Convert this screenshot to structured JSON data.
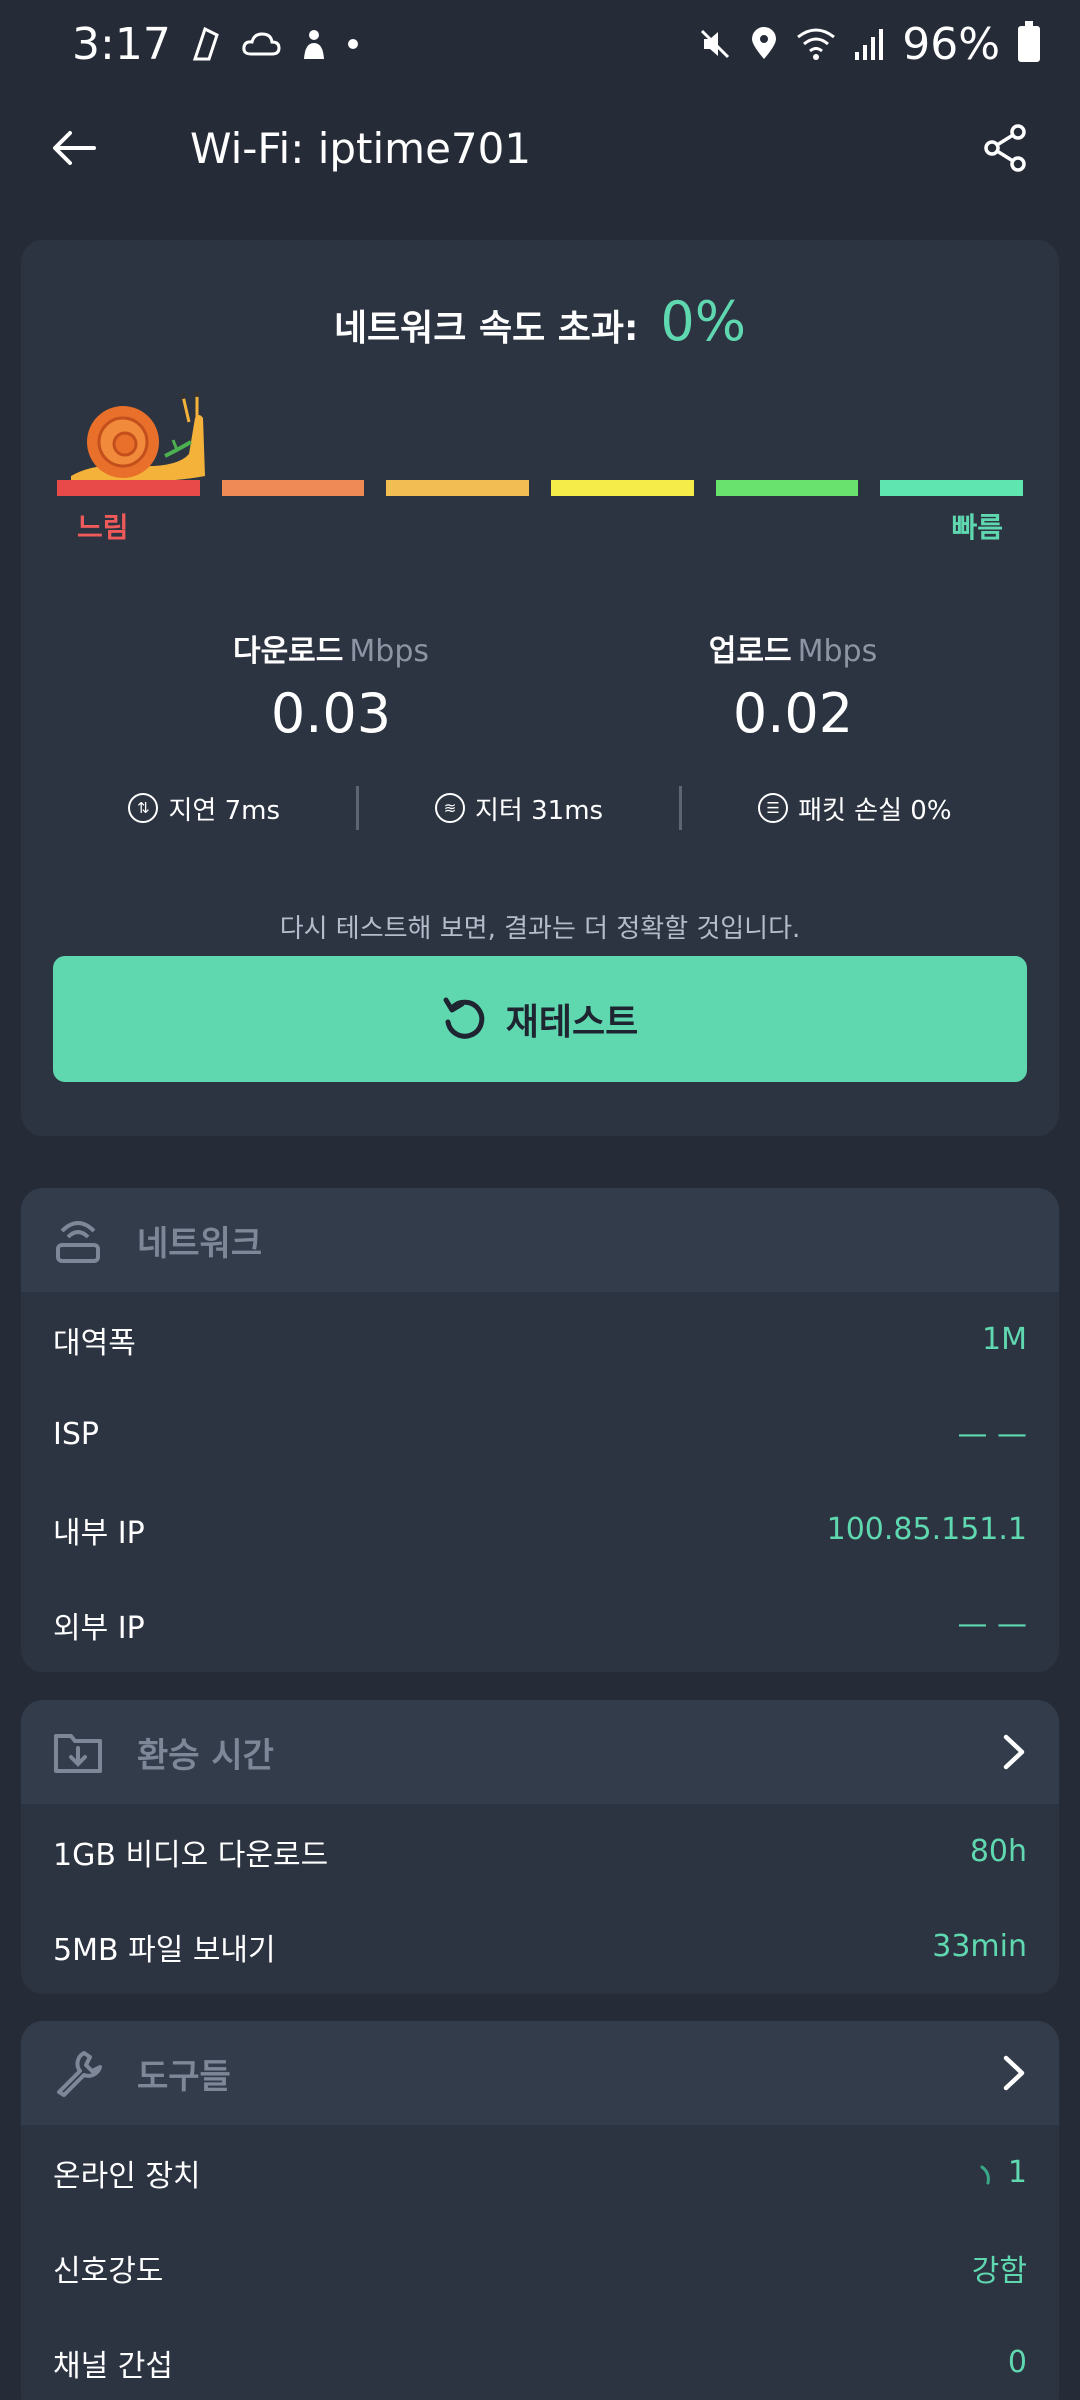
{
  "status_bar": {
    "time": "3:17",
    "battery": "96%"
  },
  "app_bar": {
    "title": "Wi-Fi: iptime701"
  },
  "result": {
    "headline_label": "네트워크 속도 초과:",
    "headline_value": "0%",
    "slow_label": "느림",
    "fast_label": "빠름",
    "speed_segments": [
      "#e84a4a",
      "#ef8a56",
      "#f2bd52",
      "#f5ec4a",
      "#6ae36e",
      "#5fe6b0"
    ],
    "download": {
      "label": "다운로드",
      "unit": "Mbps",
      "value": "0.03"
    },
    "upload": {
      "label": "업로드",
      "unit": "Mbps",
      "value": "0.02"
    },
    "stats": [
      {
        "icon": "latency-icon",
        "text": "지연 7ms"
      },
      {
        "icon": "jitter-icon",
        "text": "지터 31ms"
      },
      {
        "icon": "packet-loss-icon",
        "text": "패킷 손실 0%"
      }
    ],
    "hint": "다시 테스트해 보면, 결과는 더 정확할 것입니다.",
    "retest_label": "재테스트"
  },
  "network": {
    "title": "네트워크",
    "rows": [
      {
        "label": "대역폭",
        "value": "1M"
      },
      {
        "label": "ISP",
        "value": "— —"
      },
      {
        "label": "내부 IP",
        "value": "100.85.151.1"
      },
      {
        "label": "외부 IP",
        "value": "— —"
      }
    ]
  },
  "transfer": {
    "title": "환승 시간",
    "rows": [
      {
        "label": "1GB 비디오 다운로드",
        "value": "80h"
      },
      {
        "label": "5MB 파일 보내기",
        "value": "33min"
      }
    ]
  },
  "tools": {
    "title": "도구들",
    "rows": [
      {
        "label": "온라인 장치",
        "value": "1"
      },
      {
        "label": "신호강도",
        "value": "강함"
      },
      {
        "label": "채널 간섭",
        "value": "0"
      }
    ]
  },
  "colors": {
    "accent": "#5fd8b0",
    "background": "#262c37",
    "card": "#2c3341"
  }
}
